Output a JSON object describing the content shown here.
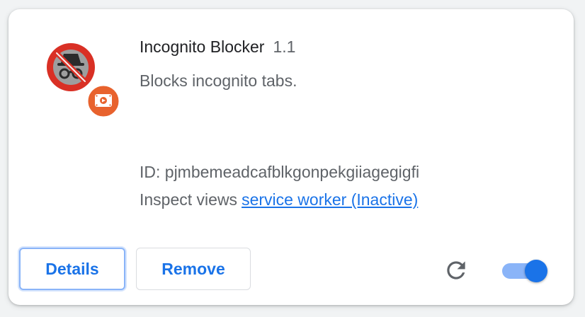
{
  "extension": {
    "name": "Incognito Blocker",
    "version": "1.1",
    "description": "Blocks incognito tabs.",
    "id_text": "ID: pjmbemeadcafblkgonpekgiiagegigfi",
    "inspect_label": "Inspect views",
    "inspect_link": "service worker (Inactive)",
    "icon": "incognito-blocked-icon",
    "badge_icon": "extension-badge-icon",
    "enabled": true
  },
  "actions": {
    "details_label": "Details",
    "remove_label": "Remove",
    "reload_icon": "reload-icon"
  },
  "colors": {
    "accent": "#1a73e8",
    "toggle_track": "#8ab4f8",
    "icon_red": "#d93025",
    "badge_orange": "#e8622d"
  }
}
